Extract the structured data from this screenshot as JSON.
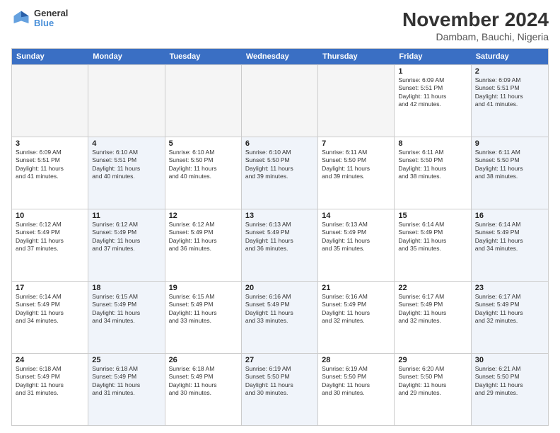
{
  "logo": {
    "general": "General",
    "blue": "Blue"
  },
  "title": "November 2024",
  "subtitle": "Dambam, Bauchi, Nigeria",
  "header": {
    "days": [
      "Sunday",
      "Monday",
      "Tuesday",
      "Wednesday",
      "Thursday",
      "Friday",
      "Saturday"
    ]
  },
  "rows": [
    [
      {
        "day": "",
        "info": "",
        "empty": true
      },
      {
        "day": "",
        "info": "",
        "empty": true
      },
      {
        "day": "",
        "info": "",
        "empty": true
      },
      {
        "day": "",
        "info": "",
        "empty": true
      },
      {
        "day": "",
        "info": "",
        "empty": true
      },
      {
        "day": "1",
        "info": "Sunrise: 6:09 AM\nSunset: 5:51 PM\nDaylight: 11 hours\nand 42 minutes.",
        "empty": false,
        "alt": false
      },
      {
        "day": "2",
        "info": "Sunrise: 6:09 AM\nSunset: 5:51 PM\nDaylight: 11 hours\nand 41 minutes.",
        "empty": false,
        "alt": true
      }
    ],
    [
      {
        "day": "3",
        "info": "Sunrise: 6:09 AM\nSunset: 5:51 PM\nDaylight: 11 hours\nand 41 minutes.",
        "empty": false,
        "alt": false
      },
      {
        "day": "4",
        "info": "Sunrise: 6:10 AM\nSunset: 5:51 PM\nDaylight: 11 hours\nand 40 minutes.",
        "empty": false,
        "alt": true
      },
      {
        "day": "5",
        "info": "Sunrise: 6:10 AM\nSunset: 5:50 PM\nDaylight: 11 hours\nand 40 minutes.",
        "empty": false,
        "alt": false
      },
      {
        "day": "6",
        "info": "Sunrise: 6:10 AM\nSunset: 5:50 PM\nDaylight: 11 hours\nand 39 minutes.",
        "empty": false,
        "alt": true
      },
      {
        "day": "7",
        "info": "Sunrise: 6:11 AM\nSunset: 5:50 PM\nDaylight: 11 hours\nand 39 minutes.",
        "empty": false,
        "alt": false
      },
      {
        "day": "8",
        "info": "Sunrise: 6:11 AM\nSunset: 5:50 PM\nDaylight: 11 hours\nand 38 minutes.",
        "empty": false,
        "alt": false
      },
      {
        "day": "9",
        "info": "Sunrise: 6:11 AM\nSunset: 5:50 PM\nDaylight: 11 hours\nand 38 minutes.",
        "empty": false,
        "alt": true
      }
    ],
    [
      {
        "day": "10",
        "info": "Sunrise: 6:12 AM\nSunset: 5:49 PM\nDaylight: 11 hours\nand 37 minutes.",
        "empty": false,
        "alt": false
      },
      {
        "day": "11",
        "info": "Sunrise: 6:12 AM\nSunset: 5:49 PM\nDaylight: 11 hours\nand 37 minutes.",
        "empty": false,
        "alt": true
      },
      {
        "day": "12",
        "info": "Sunrise: 6:12 AM\nSunset: 5:49 PM\nDaylight: 11 hours\nand 36 minutes.",
        "empty": false,
        "alt": false
      },
      {
        "day": "13",
        "info": "Sunrise: 6:13 AM\nSunset: 5:49 PM\nDaylight: 11 hours\nand 36 minutes.",
        "empty": false,
        "alt": true
      },
      {
        "day": "14",
        "info": "Sunrise: 6:13 AM\nSunset: 5:49 PM\nDaylight: 11 hours\nand 35 minutes.",
        "empty": false,
        "alt": false
      },
      {
        "day": "15",
        "info": "Sunrise: 6:14 AM\nSunset: 5:49 PM\nDaylight: 11 hours\nand 35 minutes.",
        "empty": false,
        "alt": false
      },
      {
        "day": "16",
        "info": "Sunrise: 6:14 AM\nSunset: 5:49 PM\nDaylight: 11 hours\nand 34 minutes.",
        "empty": false,
        "alt": true
      }
    ],
    [
      {
        "day": "17",
        "info": "Sunrise: 6:14 AM\nSunset: 5:49 PM\nDaylight: 11 hours\nand 34 minutes.",
        "empty": false,
        "alt": false
      },
      {
        "day": "18",
        "info": "Sunrise: 6:15 AM\nSunset: 5:49 PM\nDaylight: 11 hours\nand 34 minutes.",
        "empty": false,
        "alt": true
      },
      {
        "day": "19",
        "info": "Sunrise: 6:15 AM\nSunset: 5:49 PM\nDaylight: 11 hours\nand 33 minutes.",
        "empty": false,
        "alt": false
      },
      {
        "day": "20",
        "info": "Sunrise: 6:16 AM\nSunset: 5:49 PM\nDaylight: 11 hours\nand 33 minutes.",
        "empty": false,
        "alt": true
      },
      {
        "day": "21",
        "info": "Sunrise: 6:16 AM\nSunset: 5:49 PM\nDaylight: 11 hours\nand 32 minutes.",
        "empty": false,
        "alt": false
      },
      {
        "day": "22",
        "info": "Sunrise: 6:17 AM\nSunset: 5:49 PM\nDaylight: 11 hours\nand 32 minutes.",
        "empty": false,
        "alt": false
      },
      {
        "day": "23",
        "info": "Sunrise: 6:17 AM\nSunset: 5:49 PM\nDaylight: 11 hours\nand 32 minutes.",
        "empty": false,
        "alt": true
      }
    ],
    [
      {
        "day": "24",
        "info": "Sunrise: 6:18 AM\nSunset: 5:49 PM\nDaylight: 11 hours\nand 31 minutes.",
        "empty": false,
        "alt": false
      },
      {
        "day": "25",
        "info": "Sunrise: 6:18 AM\nSunset: 5:49 PM\nDaylight: 11 hours\nand 31 minutes.",
        "empty": false,
        "alt": true
      },
      {
        "day": "26",
        "info": "Sunrise: 6:18 AM\nSunset: 5:49 PM\nDaylight: 11 hours\nand 30 minutes.",
        "empty": false,
        "alt": false
      },
      {
        "day": "27",
        "info": "Sunrise: 6:19 AM\nSunset: 5:50 PM\nDaylight: 11 hours\nand 30 minutes.",
        "empty": false,
        "alt": true
      },
      {
        "day": "28",
        "info": "Sunrise: 6:19 AM\nSunset: 5:50 PM\nDaylight: 11 hours\nand 30 minutes.",
        "empty": false,
        "alt": false
      },
      {
        "day": "29",
        "info": "Sunrise: 6:20 AM\nSunset: 5:50 PM\nDaylight: 11 hours\nand 29 minutes.",
        "empty": false,
        "alt": false
      },
      {
        "day": "30",
        "info": "Sunrise: 6:21 AM\nSunset: 5:50 PM\nDaylight: 11 hours\nand 29 minutes.",
        "empty": false,
        "alt": true
      }
    ]
  ]
}
